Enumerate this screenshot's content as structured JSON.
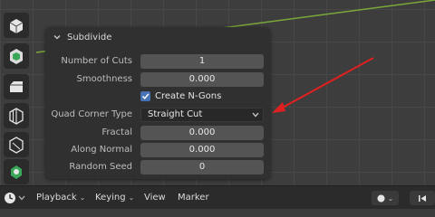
{
  "operator_panel": {
    "title": "Subdivide",
    "fields": [
      {
        "label": "Number of Cuts",
        "value": "1"
      },
      {
        "label": "Smoothness",
        "value": "0.000"
      }
    ],
    "checkbox": {
      "label": "Create N-Gons",
      "checked": true
    },
    "quad_corner": {
      "label": "Quad Corner Type",
      "value": "Straight Cut"
    },
    "fields_after": [
      {
        "label": "Fractal",
        "value": "0.000"
      },
      {
        "label": "Along Normal",
        "value": "0.000"
      },
      {
        "label": "Random Seed",
        "value": "0"
      }
    ]
  },
  "toolbar": {
    "tools": [
      "extrude-region-icon",
      "inset-faces-icon",
      "bevel-icon",
      "loop-cut-icon",
      "knife-icon",
      "poly-build-icon",
      "spin-icon"
    ]
  },
  "timeline": {
    "menus": [
      {
        "label": "Playback"
      },
      {
        "label": "Keying"
      },
      {
        "label": "View"
      },
      {
        "label": "Marker"
      }
    ]
  },
  "colors": {
    "accent": "#4772b3",
    "annotation_arrow": "#e02020",
    "y_axis": "#7aa83a"
  }
}
